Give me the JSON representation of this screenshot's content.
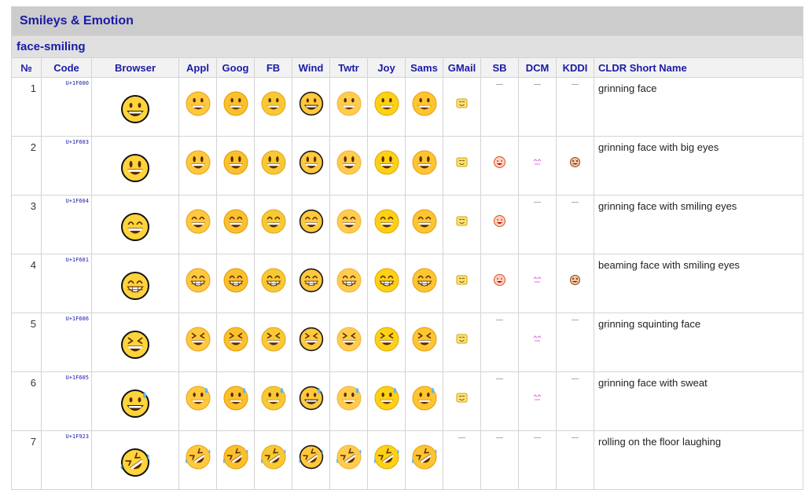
{
  "section_title": "Smileys & Emotion",
  "subsection_title": "face-smiling",
  "columns": [
    "№",
    "Code",
    "Browser",
    "Appl",
    "Goog",
    "FB",
    "Wind",
    "Twtr",
    "Joy",
    "Sams",
    "GMail",
    "SB",
    "DCM",
    "KDDI",
    "CLDR Short Name"
  ],
  "rows": [
    {
      "num": "1",
      "code": "U+1F600",
      "name": "grinning face",
      "face": "grin",
      "gmail": true,
      "sb": false,
      "dcm": false,
      "kddi": false
    },
    {
      "num": "2",
      "code": "U+1F603",
      "name": "grinning face with big eyes",
      "face": "bigeyes",
      "gmail": true,
      "sb": true,
      "dcm": true,
      "kddi": true
    },
    {
      "num": "3",
      "code": "U+1F604",
      "name": "grinning face with smiling eyes",
      "face": "smileeyes",
      "gmail": true,
      "sb": true,
      "dcm": false,
      "kddi": false
    },
    {
      "num": "4",
      "code": "U+1F601",
      "name": "beaming face with smiling eyes",
      "face": "beam",
      "gmail": true,
      "sb": true,
      "dcm": true,
      "kddi": true
    },
    {
      "num": "5",
      "code": "U+1F606",
      "name": "grinning squinting face",
      "face": "squint",
      "gmail": true,
      "sb": false,
      "dcm": true,
      "kddi": false
    },
    {
      "num": "6",
      "code": "U+1F605",
      "name": "grinning face with sweat",
      "face": "sweat",
      "gmail": true,
      "sb": false,
      "dcm": true,
      "kddi": false
    },
    {
      "num": "7",
      "code": "U+1F923",
      "name": "rolling on the floor laughing",
      "face": "rofl",
      "gmail": false,
      "sb": false,
      "dcm": false,
      "kddi": false
    }
  ],
  "vendors": [
    {
      "key": "appl",
      "fill": "#ffc83d",
      "stroke": "#e0a21b"
    },
    {
      "key": "goog",
      "fill": "#fbc02d",
      "stroke": "#e09a00"
    },
    {
      "key": "fb",
      "fill": "#f7c934",
      "stroke": "#e3a419"
    },
    {
      "key": "wind",
      "fill": "#ffc83d",
      "stroke": "#1a1a1a"
    },
    {
      "key": "twtr",
      "fill": "#ffcc4d",
      "stroke": "#f4b23a"
    },
    {
      "key": "joy",
      "fill": "#fcd116",
      "stroke": "#e3a700"
    },
    {
      "key": "sams",
      "fill": "#fdc630",
      "stroke": "#e59a13"
    }
  ],
  "browser_color": {
    "fill": "#ffd43b",
    "stroke": "#111111"
  }
}
